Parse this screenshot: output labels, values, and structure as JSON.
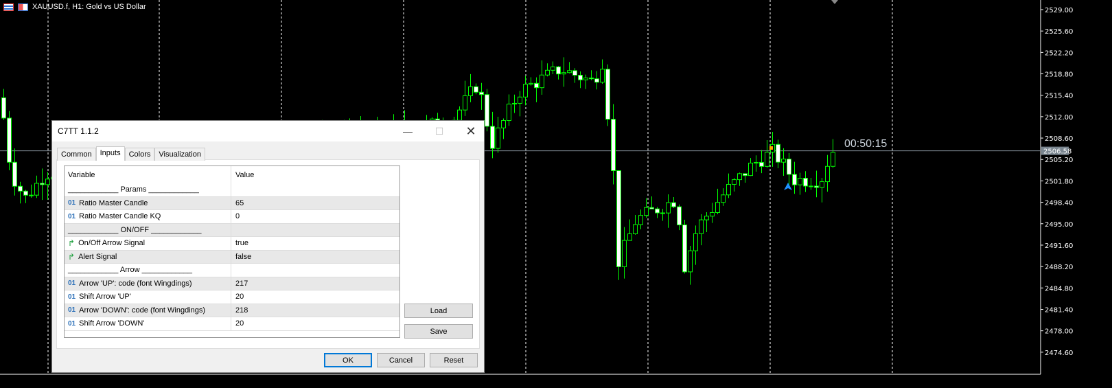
{
  "chart": {
    "title": "XAUUSD.f, H1:  Gold vs US Dollar",
    "timer": "00:50:15",
    "current_price": "2506.58",
    "current_price_value": 2506.58,
    "price_ticks": [
      "2529.00",
      "2525.60",
      "2522.20",
      "2518.80",
      "2515.40",
      "2512.00",
      "2508.60",
      "2505.20",
      "2501.80",
      "2498.40",
      "2495.00",
      "2491.60",
      "2488.20",
      "2484.80",
      "2481.40",
      "2478.00",
      "2474.60"
    ],
    "price_path": [
      [
        0,
        2519
      ],
      [
        20,
        2503
      ],
      [
        40,
        2499
      ],
      [
        70,
        2503
      ],
      [
        660,
        2511
      ],
      [
        700,
        2517.4
      ],
      [
        720,
        2507.6
      ],
      [
        760,
        2516
      ],
      [
        820,
        2519.6
      ],
      [
        870,
        2517.4
      ],
      [
        880,
        2521.8
      ],
      [
        895,
        2506.5
      ],
      [
        905,
        2489
      ],
      [
        930,
        2495.6
      ],
      [
        990,
        2499
      ],
      [
        1000,
        2488
      ],
      [
        1020,
        2494.5
      ],
      [
        1060,
        2500
      ],
      [
        1100,
        2504.4
      ],
      [
        1130,
        2506.5
      ],
      [
        1160,
        2502
      ],
      [
        1200,
        2502
      ],
      [
        1215,
        2506.6
      ]
    ],
    "colors": {
      "candle": "#00ff00",
      "bg": "#000000",
      "grid": "#ffffff",
      "price_line": "#8a96a0"
    }
  },
  "dialog": {
    "title": "C7TT 1.1.2",
    "tabs": [
      "Common",
      "Inputs",
      "Colors",
      "Visualization"
    ],
    "active_tab": "Inputs",
    "columns": [
      "Variable",
      "Value"
    ],
    "rows": [
      {
        "icon": "",
        "name": "____________ Params ____________",
        "value": ""
      },
      {
        "icon": "int",
        "name": "Ratio Master Candle",
        "value": "65"
      },
      {
        "icon": "int",
        "name": "Ratio Master Candle KQ",
        "value": "0"
      },
      {
        "icon": "",
        "name": "____________ ON/OFF ____________",
        "value": ""
      },
      {
        "icon": "bool",
        "name": "On/Off Arrow Signal",
        "value": "true"
      },
      {
        "icon": "bool",
        "name": "Alert Signal",
        "value": "false"
      },
      {
        "icon": "",
        "name": "____________ Arrow ____________",
        "value": ""
      },
      {
        "icon": "int",
        "name": "Arrow 'UP': code (font Wingdings)",
        "value": "217"
      },
      {
        "icon": "int",
        "name": "Shift Arrow 'UP'",
        "value": "20"
      },
      {
        "icon": "int",
        "name": "Arrow 'DOWN': code (font Wingdings)",
        "value": "218"
      },
      {
        "icon": "int",
        "name": "Shift Arrow 'DOWN'",
        "value": "20"
      }
    ],
    "int_icon": "01",
    "bool_icon": "↱",
    "buttons": {
      "load": "Load",
      "save": "Save",
      "ok": "OK",
      "cancel": "Cancel",
      "reset": "Reset"
    }
  }
}
